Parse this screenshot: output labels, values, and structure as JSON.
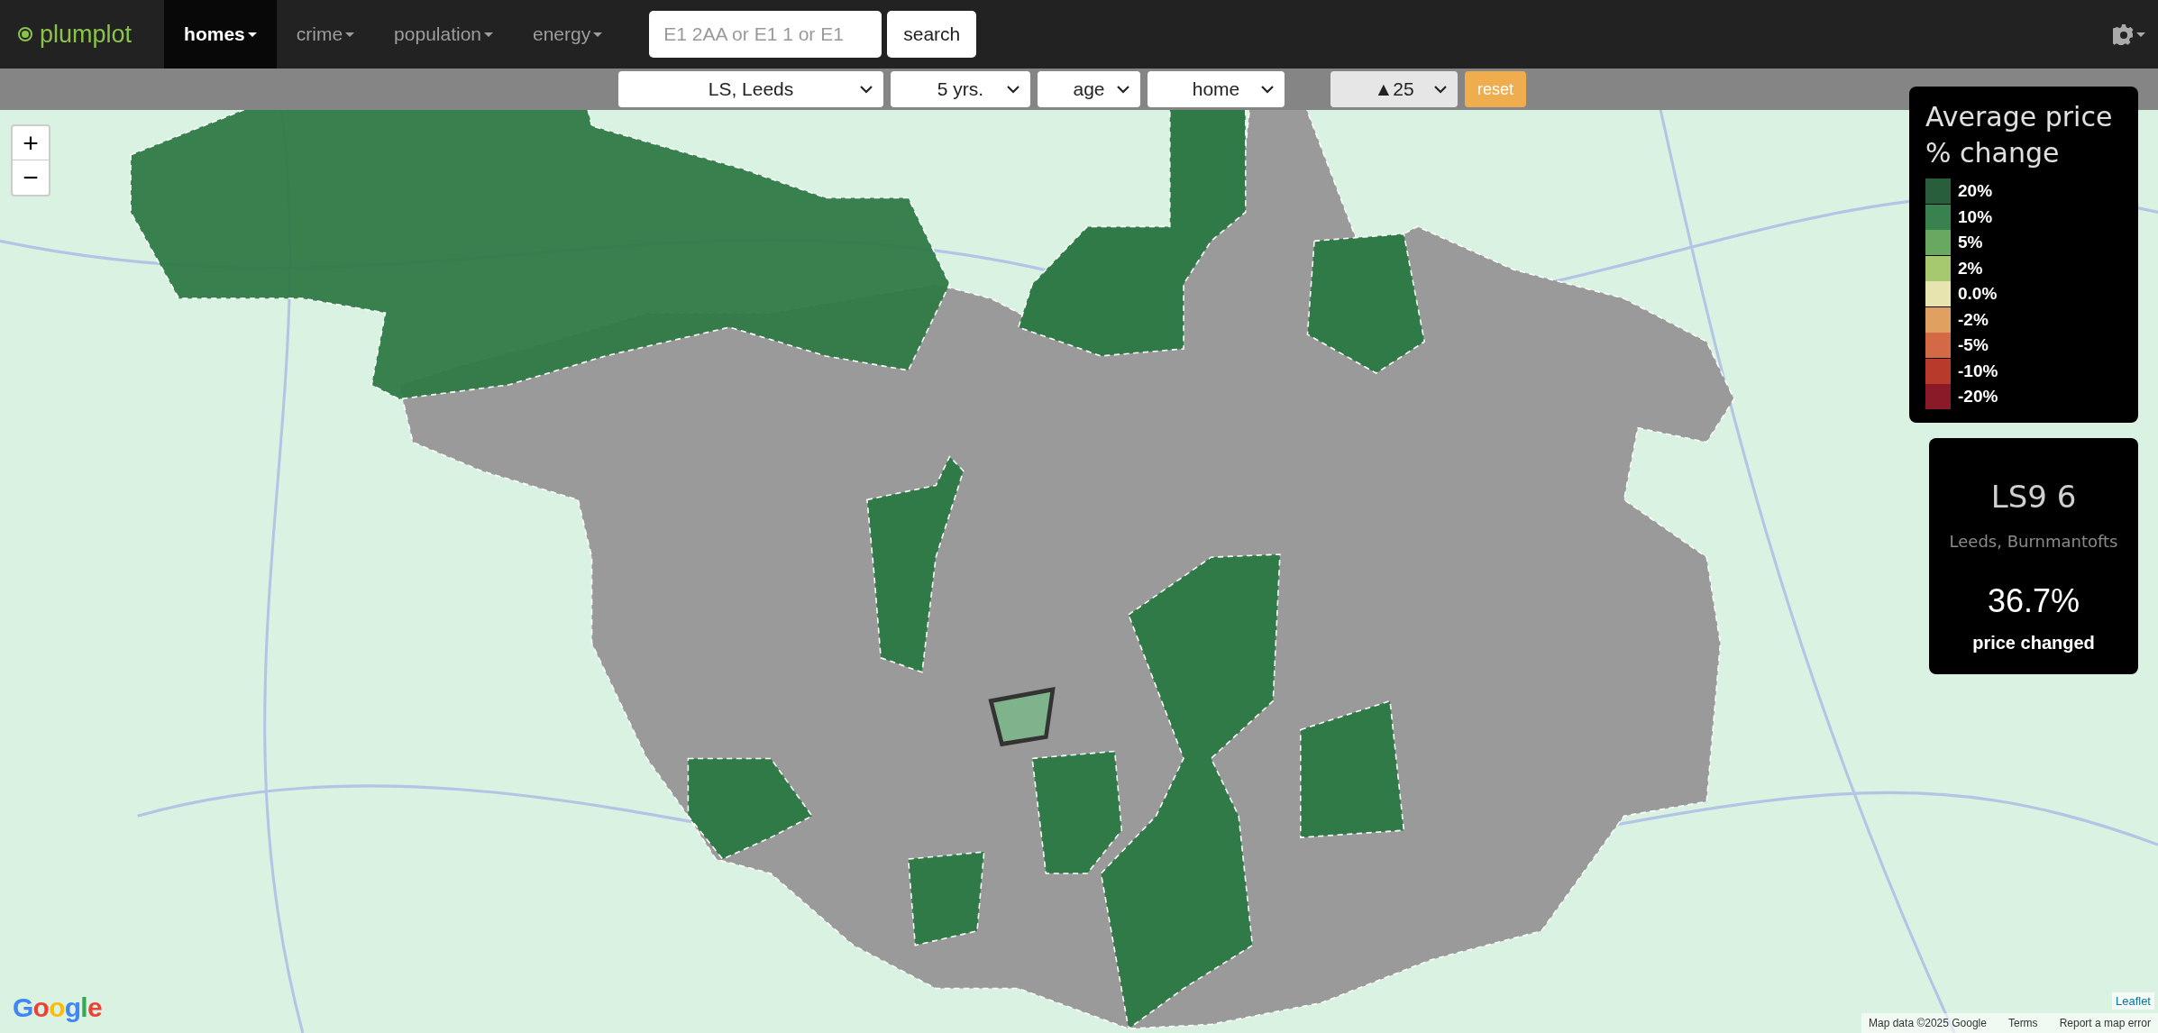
{
  "nav": {
    "logo": "plumplot",
    "menu": [
      {
        "label": "homes",
        "selected": true
      },
      {
        "label": "crime",
        "selected": false
      },
      {
        "label": "population",
        "selected": false
      },
      {
        "label": "energy",
        "selected": false
      }
    ],
    "search": {
      "placeholder": "E1 2AA or E1 1 or E1",
      "button": "search"
    }
  },
  "filters": [
    {
      "kind": "select",
      "value": "LS, Leeds"
    },
    {
      "kind": "select",
      "value": "5 yrs."
    },
    {
      "kind": "select",
      "value": "age"
    },
    {
      "kind": "select",
      "value": "home"
    },
    {
      "kind": "rank",
      "value": "▲25"
    },
    {
      "kind": "button",
      "value": "reset"
    }
  ],
  "legend": {
    "title": "Average price % change",
    "items": [
      {
        "label": "20%",
        "color": "#285e3b"
      },
      {
        "label": "10%",
        "color": "#3a8150"
      },
      {
        "label": "5%",
        "color": "#69a860"
      },
      {
        "label": "2%",
        "color": "#a6c970"
      },
      {
        "label": "0.0%",
        "color": "#e8e4b0"
      },
      {
        "label": "-2%",
        "color": "#e0a060"
      },
      {
        "label": "-5%",
        "color": "#d46a45"
      },
      {
        "label": "-10%",
        "color": "#b83a2a"
      },
      {
        "label": "-20%",
        "color": "#8b1a28"
      }
    ]
  },
  "info": {
    "postcode": "LS9 6",
    "area": "Leeds, Burnmantofts",
    "value": "36.7%",
    "caption": "price changed"
  },
  "map": {
    "zoom_in": "+",
    "zoom_out": "−",
    "logo": "Google",
    "leaflet": "Leaflet",
    "attribution": [
      "Map data ©2025 Google",
      "Terms",
      "Report a map error"
    ]
  }
}
